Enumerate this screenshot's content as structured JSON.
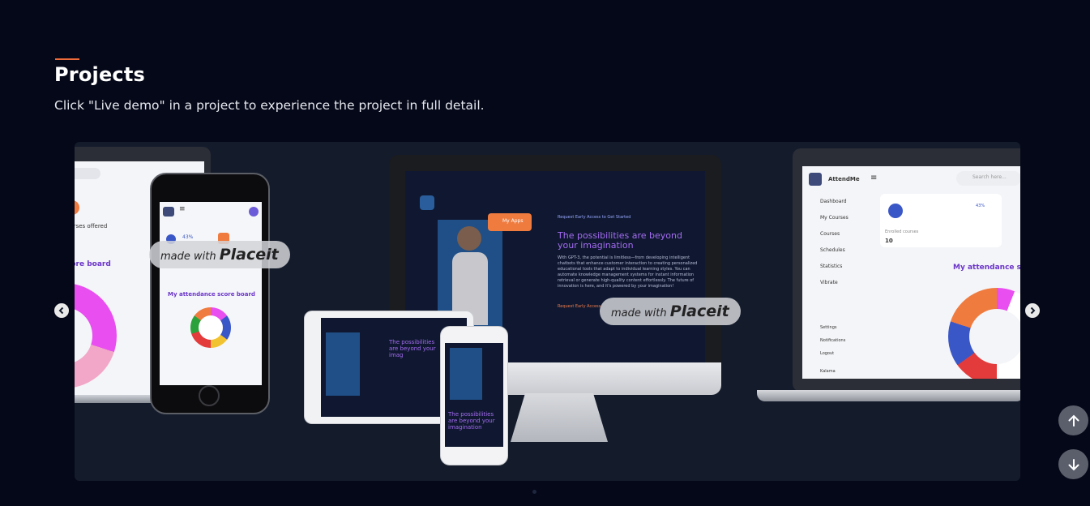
{
  "section": {
    "title": "Projects",
    "subtitle": "Click \"Live demo\" in a project to experience the project in full detail."
  },
  "carousel": {
    "prev_icon": "chevron-left-icon",
    "next_icon": "chevron-right-icon",
    "mockup": {
      "watermark_prefix": "made with",
      "watermark_brand": "Placeit",
      "left_app": {
        "courses_offered": "ourses offered",
        "score_board": "core board",
        "phone_score_board": "My attendance score board",
        "badge": "43%"
      },
      "center_app": {
        "tag": "Request Early Access to Get Started",
        "heading": "The possibilities are beyond your imagination",
        "body": "With GPT-3, the potential is limitless—from developing intelligent chatbots that enhance customer interaction to creating personalized educational tools that adapt to individual learning styles. You can automate knowledge management systems for instant information retrieval or generate high-quality content effortlessly. The future of innovation is here, and it's powered by your imagination!",
        "cta": "Request Early Access",
        "button": "My Apps",
        "tablet_heading": "The possibilities are beyond your imag",
        "iphone_heading": "The possibilities are beyond your imagination"
      },
      "right_app": {
        "brand": "AttendMe",
        "search_placeholder": "Search here...",
        "nav": [
          "Dashboard",
          "My Courses",
          "Courses",
          "Schedules",
          "Statistics",
          "Vibrate"
        ],
        "bottom_nav": [
          "Settings",
          "Notifications",
          "Logout"
        ],
        "user": "Kalama",
        "enrolled_label": "Enrolled courses",
        "enrolled_value": "10",
        "badge": "43%",
        "score_board": "My attendance sc"
      }
    }
  },
  "scroll": {
    "up_icon": "arrow-up-icon",
    "down_icon": "arrow-down-icon"
  }
}
